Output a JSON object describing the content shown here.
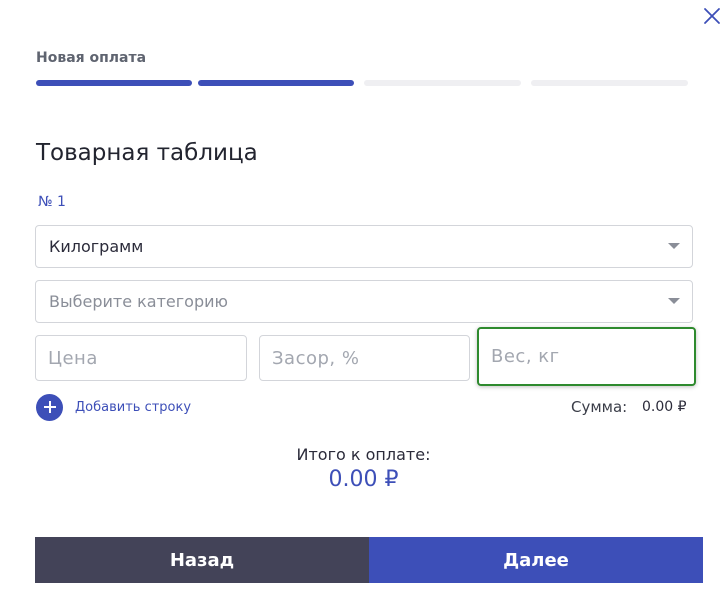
{
  "header": {
    "step_label": "Новая оплата",
    "steps_total": 4,
    "steps_completed": 2
  },
  "section": {
    "title": "Товарная таблица",
    "row_number": "№ 1"
  },
  "unit_select": {
    "value": "Килограмм"
  },
  "category_select": {
    "placeholder": "Выберите категорию"
  },
  "fields": {
    "price_placeholder": "Цена",
    "waste_placeholder": "Засор, %",
    "weight_placeholder": "Вес, кг"
  },
  "add_row": {
    "label": "Добавить строку"
  },
  "sum": {
    "label": "Сумма:",
    "value": "0.00 ₽"
  },
  "total": {
    "label": "Итого к оплате:",
    "value": "0.00 ₽"
  },
  "buttons": {
    "back": "Назад",
    "next": "Далее"
  },
  "colors": {
    "accent": "#3d4fb8",
    "back_button": "#434358",
    "focus_border": "#2e8a2e"
  }
}
